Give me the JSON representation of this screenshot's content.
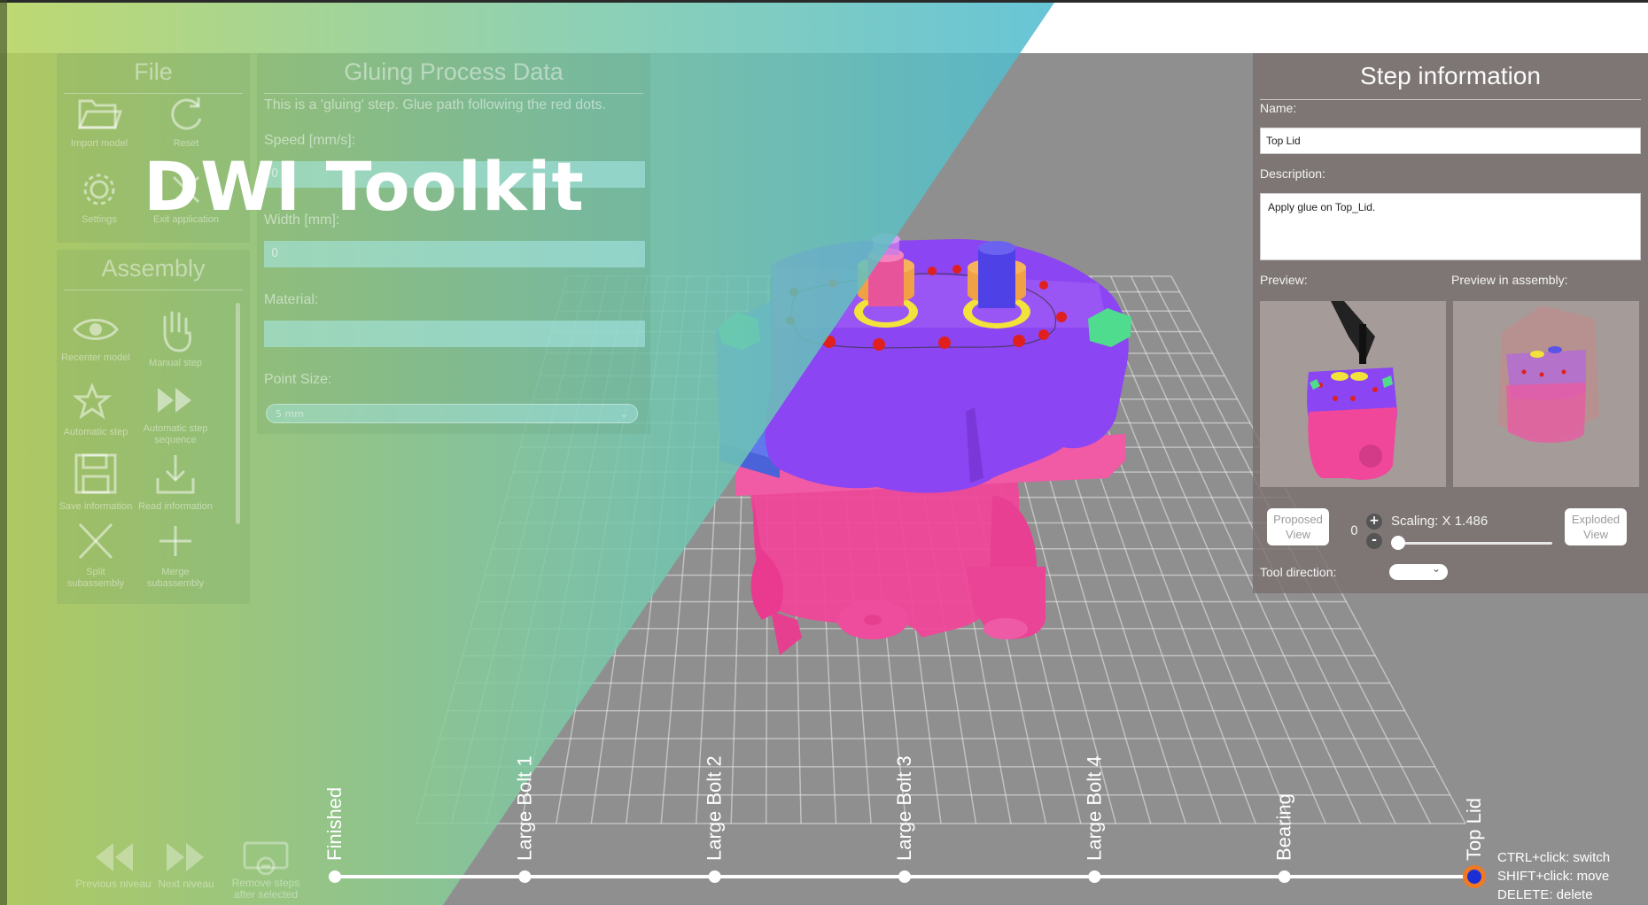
{
  "brand": {
    "title": "DWI Toolkit"
  },
  "file_panel": {
    "title": "File",
    "tools": [
      {
        "label": "Import model",
        "icon": "folder-open-icon"
      },
      {
        "label": "Reset",
        "icon": "refresh-icon"
      },
      {
        "label": "Settings",
        "icon": "gear-icon"
      },
      {
        "label": "Exit application",
        "icon": "close-icon"
      }
    ]
  },
  "assembly_panel": {
    "title": "Assembly",
    "tools": [
      {
        "label": "Recenter model",
        "icon": "eye-icon"
      },
      {
        "label": "Manual step",
        "icon": "hand-icon"
      },
      {
        "label": "Automatic step",
        "icon": "magic-star-icon"
      },
      {
        "label": "Automatic step sequence",
        "icon": "fast-forward-icon"
      },
      {
        "label": "Save information",
        "icon": "save-icon"
      },
      {
        "label": "Read information",
        "icon": "download-icon"
      },
      {
        "label": "Split subassembly",
        "icon": "split-x-icon"
      },
      {
        "label": "Merge subassembly",
        "icon": "plus-icon"
      }
    ]
  },
  "glue_panel": {
    "title": "Gluing Process Data",
    "description": "This is a 'gluing' step. Glue path following the red dots.",
    "speed_label": "Speed [mm/s]:",
    "speed_value": "0",
    "width_label": "Width [mm]:",
    "width_value": "0",
    "material_label": "Material:",
    "material_value": "",
    "point_size_label": "Point Size:",
    "point_size_value": "5 mm"
  },
  "step_panel": {
    "title": "Step information",
    "name_label": "Name:",
    "name_value": "Top Lid",
    "description_label": "Description:",
    "description_value": "Apply glue on Top_Lid.",
    "preview_label": "Preview:",
    "preview_assembly_label": "Preview in assembly:",
    "proposed_view_label": "Proposed View",
    "exploded_view_label": "Exploded View",
    "zero_label": "0",
    "scaling_label": "Scaling: X 1.486",
    "scaling_value": 1.486,
    "slider_fraction": 0.0,
    "tool_direction_label": "Tool direction:",
    "plus_label": "+",
    "minus_label": "-"
  },
  "timeline": {
    "steps": [
      "Finished",
      "Large Bolt 1",
      "Large Bolt 2",
      "Large Bolt 3",
      "Large Bolt 4",
      "Bearing",
      "Top Lid"
    ],
    "selected_index": 6,
    "hints": [
      "CTRL+click: switch",
      "SHIFT+click: move",
      "DELETE: delete"
    ]
  },
  "bottom_tools": [
    {
      "label": "Previous niveau",
      "icon": "rewind-icon"
    },
    {
      "label": "Next niveau",
      "icon": "fast-forward-icon"
    },
    {
      "label": "Remove steps after selected",
      "icon": "remove-steps-icon"
    }
  ],
  "colors": {
    "overlay_start": "#b4d25a",
    "overlay_end": "#2aa0c8",
    "model_pink": "#f0479a",
    "model_purple": "#8b45f2",
    "model_blue": "#4f6ae0",
    "glue_dot_red": "#e0201e",
    "selected_step_orange": "#f07a22",
    "selected_step_blue": "#1c2fd6"
  }
}
